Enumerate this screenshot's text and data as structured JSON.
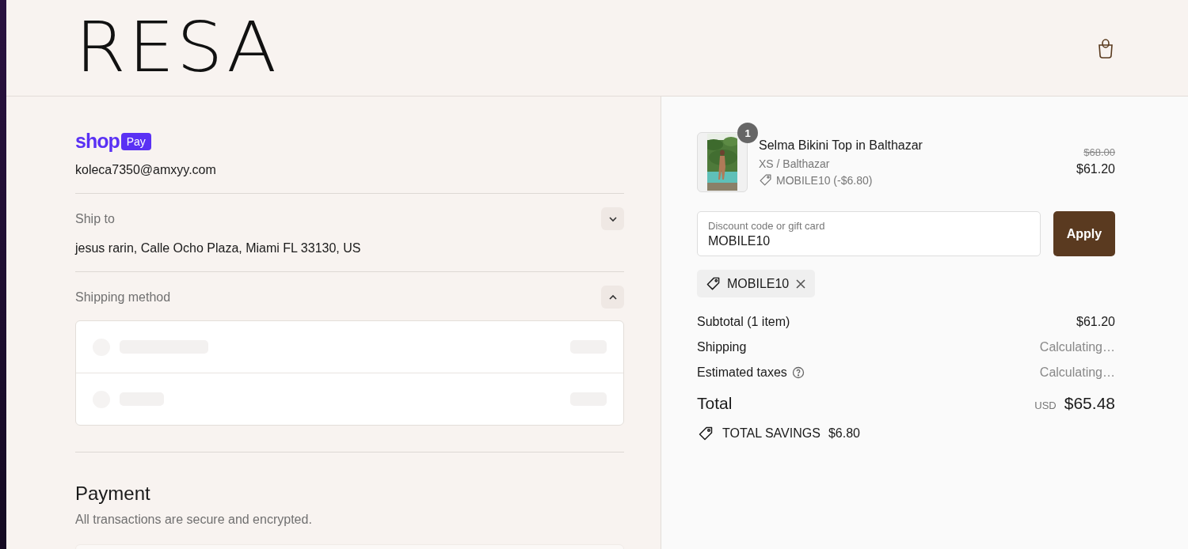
{
  "header": {
    "logo": "RESA"
  },
  "contact": {
    "wallet_brand": "shop",
    "wallet_badge": "Pay",
    "email": "koleca7350@amxyy.com"
  },
  "ship_to": {
    "label": "Ship to",
    "value": "jesus rarin, Calle Ocho Plaza, Miami FL 33130, US",
    "expanded": false
  },
  "shipping_method": {
    "label": "Shipping method",
    "expanded": true,
    "loading": true
  },
  "payment": {
    "title": "Payment",
    "subtitle": "All transactions are secure and encrypted."
  },
  "cart": {
    "items": [
      {
        "quantity": "1",
        "title": "Selma Bikini Top in Balthazar",
        "variant": "XS / Balthazar",
        "discount": "MOBILE10 (-$6.80)",
        "original_price": "$68.00",
        "price": "$61.20"
      }
    ]
  },
  "discount_field": {
    "placeholder": "Discount code or gift card",
    "value": "MOBILE10",
    "button": "Apply"
  },
  "applied_codes": [
    "MOBILE10"
  ],
  "summary": [
    {
      "label": "Subtotal (1 item)",
      "value": "$61.20",
      "pending": false,
      "help": false
    },
    {
      "label": "Shipping",
      "value": "Calculating…",
      "pending": true,
      "help": false
    },
    {
      "label": "Estimated taxes",
      "value": "Calculating…",
      "pending": true,
      "help": true
    }
  ],
  "total": {
    "label": "Total",
    "currency": "USD",
    "amount": "$65.48"
  },
  "savings": {
    "label": "TOTAL SAVINGS",
    "amount": "$6.80"
  }
}
